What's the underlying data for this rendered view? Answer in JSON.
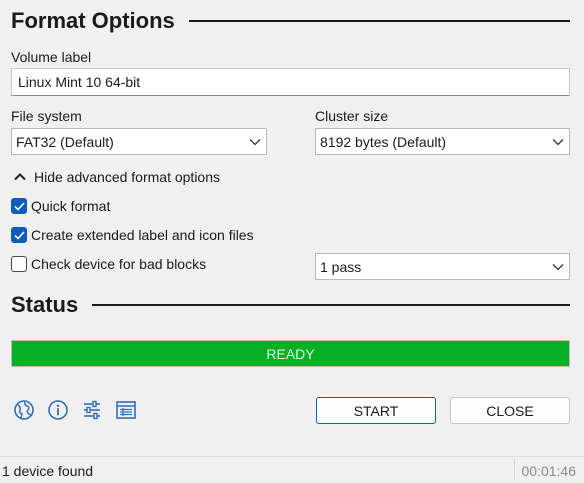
{
  "format_options": {
    "title": "Format Options",
    "volume_label": {
      "label": "Volume label",
      "value": "Linux Mint 10 64-bit"
    },
    "file_system": {
      "label": "File system",
      "value": "FAT32 (Default)"
    },
    "cluster_size": {
      "label": "Cluster size",
      "value": "8192 bytes (Default)"
    },
    "advanced_toggle": {
      "label": "Hide advanced format options",
      "icon": "chevron-up-icon"
    },
    "quick_format": {
      "label": "Quick format",
      "checked": true
    },
    "extended_label": {
      "label": "Create extended label and icon files",
      "checked": true
    },
    "bad_blocks": {
      "label": "Check device for bad blocks",
      "checked": false,
      "passes": "1 pass"
    }
  },
  "status": {
    "title": "Status",
    "progress_text": "READY",
    "progress_percent": 100,
    "progress_color": "#06b025"
  },
  "toolbar": {
    "icons": [
      "globe-icon",
      "info-icon",
      "settings-sliders-icon",
      "log-icon"
    ]
  },
  "buttons": {
    "start": "START",
    "close": "CLOSE"
  },
  "statusbar": {
    "devices": "1 device found",
    "elapsed": "00:01:46"
  },
  "colors": {
    "accent": "#0a5db8",
    "ready_green": "#06b025"
  }
}
